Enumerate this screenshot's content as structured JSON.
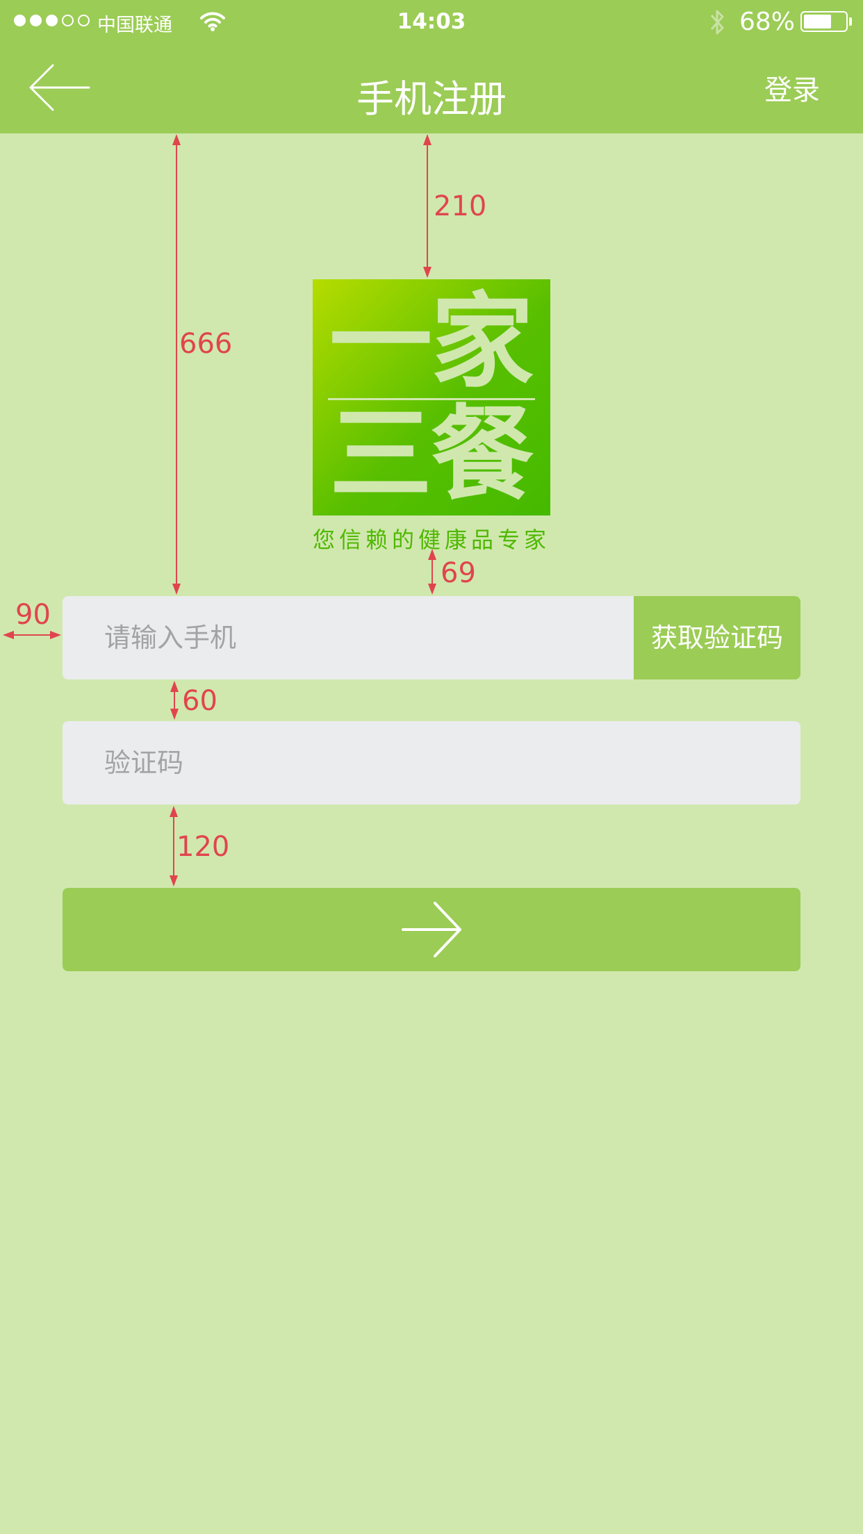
{
  "status_bar": {
    "carrier": "中国联通",
    "time": "14:03",
    "battery_percent": "68%",
    "battery_level": 0.68,
    "signal_bars_filled": 3,
    "signal_bars_total": 5,
    "icons": [
      "signal-dots-icon",
      "wifi-icon",
      "bluetooth-icon",
      "battery-icon"
    ]
  },
  "nav": {
    "title": "手机注册",
    "login_label": "登录",
    "back_icon": "back-arrow-icon"
  },
  "logo": {
    "char1": "一",
    "char2": "家",
    "char3": "三",
    "char4": "餐",
    "tagline": "您信赖的健康品专家"
  },
  "form": {
    "phone_placeholder": "请输入手机",
    "get_code_label": "获取验证码",
    "code_placeholder": "验证码",
    "submit_icon": "arrow-right-icon"
  },
  "annotations": {
    "logo_top_gap": "210",
    "form_top_gap": "666",
    "logo_to_field_gap": "69",
    "side_margin": "90",
    "field_gap": "60",
    "button_gap": "120"
  },
  "colors": {
    "primary_green": "#9bcc55",
    "background": "#d0e8ae",
    "field_bg": "#ebecee",
    "annotation_red": "#e0454e",
    "tagline_green": "#4fb800"
  }
}
